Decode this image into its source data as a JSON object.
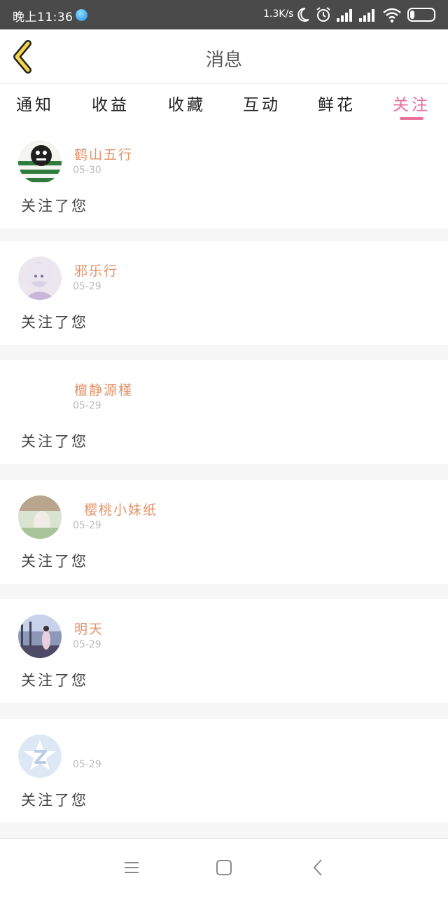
{
  "status_bar": {
    "time": "晚上11:36",
    "net_speed": "1.3K/s",
    "battery_level": "18",
    "battery_fraction": 0.18
  },
  "header": {
    "back_icon": "chevron-left-icon",
    "title": "消息"
  },
  "tabs": [
    {
      "label": "通知",
      "active": false
    },
    {
      "label": "收益",
      "active": false
    },
    {
      "label": "收藏",
      "active": false
    },
    {
      "label": "互动",
      "active": false
    },
    {
      "label": "鲜花",
      "active": false
    },
    {
      "label": "关注",
      "active": true
    }
  ],
  "colors": {
    "accent": "#e8709a",
    "username": "#e4936a",
    "date": "#bbbbbb",
    "back_arrow": "#f2d34a",
    "statusbar": "#4a4a4a"
  },
  "notifications": [
    {
      "name": "鹤山五行",
      "date": "05-30",
      "action": "关注了您",
      "avatar": "avatar-green-stripes"
    },
    {
      "name": "邪乐行",
      "date": "05-29",
      "action": "关注了您",
      "avatar": "avatar-anime-girl"
    },
    {
      "name": "檀静源槿",
      "date": "05-29",
      "action": "关注了您",
      "avatar": "avatar-blank"
    },
    {
      "name": "樱桃小妹纸",
      "date": "05-29",
      "action": "关注了您",
      "avatar": "avatar-photo-girl"
    },
    {
      "name": "明天",
      "date": "05-29",
      "action": "关注了您",
      "avatar": "avatar-street-photo"
    },
    {
      "name": "",
      "date": "05-29",
      "action": "关注了您",
      "avatar": "avatar-qq-default"
    }
  ],
  "nav_bar": [
    "menu-icon",
    "home-square-icon",
    "back-icon"
  ]
}
